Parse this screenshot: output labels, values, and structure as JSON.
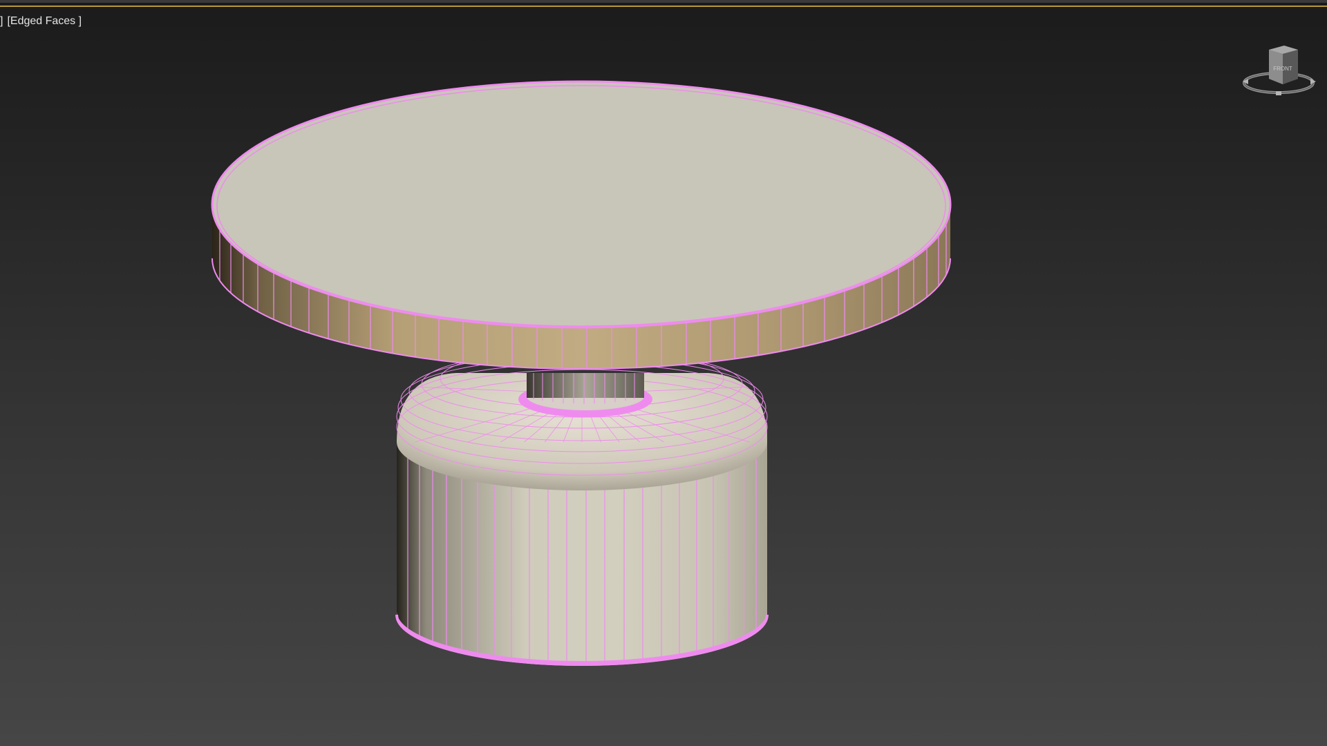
{
  "viewport": {
    "label_left": "]",
    "label_shading": "[Edged Faces ]"
  },
  "viewcube": {
    "face_label": "FRONT"
  },
  "colors": {
    "wireframe": "#ef8bef",
    "tabletop": "#c8c6b8",
    "table_edge": "#b9a37c",
    "pedestal": "#cbc8b8"
  },
  "scene": {
    "object": "round pedestal coffee table",
    "icons": [
      "viewcube-icon"
    ]
  }
}
